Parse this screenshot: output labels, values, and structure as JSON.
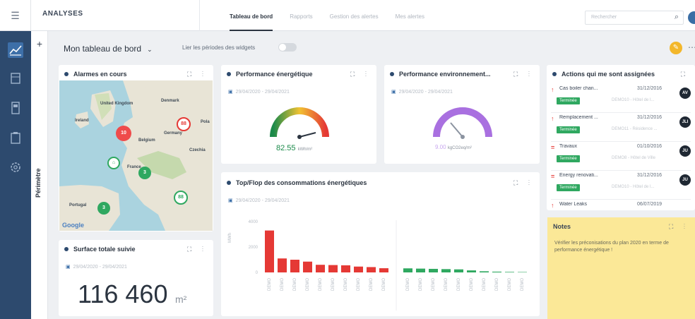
{
  "topbar": {
    "title": "ANALYSES",
    "tabs": [
      "Tableau de bord",
      "Rapports",
      "Gestion des alertes",
      "Mes alertes"
    ],
    "search_placeholder": "Rechercher"
  },
  "header": {
    "dashboard_title": "Mon tableau de bord",
    "link_periods_label": "Lier les périodes des widgets"
  },
  "sidebar": {
    "perimeter_label": "Périmètre"
  },
  "alarms": {
    "title": "Alarmes en cours",
    "map_labels": [
      "United Kingdom",
      "Ireland",
      "Denmark",
      "Germany",
      "France",
      "Portugal",
      "Pola",
      "Belgium",
      "Czechia"
    ],
    "pins": [
      "10",
      "88",
      "3",
      "88",
      "3"
    ],
    "google": "Google"
  },
  "perf_energy": {
    "title": "Performance énergétique",
    "date": "29/04/2020 - 29/04/2021",
    "value": "82.55",
    "unit": "kWh/m²",
    "gauge_value": 0.65
  },
  "perf_env": {
    "title": "Performance environnement...",
    "date": "29/04/2020 - 29/04/2021",
    "value": "9.00",
    "unit": "kgCO2eq/m²",
    "gauge_value": 0.35
  },
  "surface": {
    "title": "Surface totale suivie",
    "date": "29/04/2020 - 29/04/2021",
    "value": "116 460",
    "unit": "m²"
  },
  "topflop": {
    "title": "Top/Flop des consommations énergétiques",
    "date": "29/04/2020 - 29/04/2021"
  },
  "chart_data": {
    "type": "bar",
    "ylabel": "MWh",
    "ylim": [
      0,
      4000
    ],
    "yticks": [
      "4000",
      "2000",
      "0"
    ],
    "series": [
      {
        "name": "Top",
        "color": "#e53935",
        "categories": [
          "DEMO",
          "DEMO",
          "DEMO",
          "DEMO",
          "DEMO",
          "DEMO",
          "DEMO",
          "DEMO",
          "DEMO",
          "DEMO"
        ],
        "values": [
          3300,
          1100,
          1000,
          850,
          600,
          580,
          560,
          460,
          420,
          330
        ]
      },
      {
        "name": "Flop",
        "color": "#2fa860",
        "categories": [
          "DEMO",
          "DEMO",
          "DEMO",
          "DEMO",
          "DEMO",
          "DEMO",
          "DEMO",
          "DEMO",
          "DEMO",
          "DEMO"
        ],
        "values": [
          320,
          300,
          280,
          260,
          240,
          160,
          90,
          60,
          40,
          30
        ]
      }
    ]
  },
  "actions": {
    "title": "Actions qui me sont assignées",
    "items": [
      {
        "name": "Cas boiler chan...",
        "date": "31/12/2016",
        "status": "Terminée",
        "site": "DEMO10 - Hôtel de l...",
        "avatar": "AV",
        "prio": "↑"
      },
      {
        "name": "Remplacement ...",
        "date": "31/12/2016",
        "status": "Terminée",
        "site": "DEMO11 - Résidence ...",
        "avatar": "JLI",
        "prio": "↑"
      },
      {
        "name": "Travaux",
        "date": "01/10/2016",
        "status": "Terminée",
        "site": "DEMO8 - Hôtel de Ville",
        "avatar": "JU",
        "prio": "="
      },
      {
        "name": "Energy renovati...",
        "date": "31/12/2016",
        "status": "Terminée",
        "site": "DEMO10 - Hôtel de l...",
        "avatar": "JU",
        "prio": "="
      },
      {
        "name": "Water Leaks",
        "date": "06/07/2019",
        "status": "",
        "site": "",
        "avatar": "",
        "prio": "↑"
      }
    ]
  },
  "notes": {
    "title": "Notes",
    "text": "Vérifier les préconisations du plan 2020 en terme de performance énergétique !"
  },
  "colors": {
    "nav": "#2d4a6e",
    "accent": "#3d6fa8",
    "red": "#e53935",
    "green": "#2fa860",
    "notes_bg": "#fbe897"
  }
}
